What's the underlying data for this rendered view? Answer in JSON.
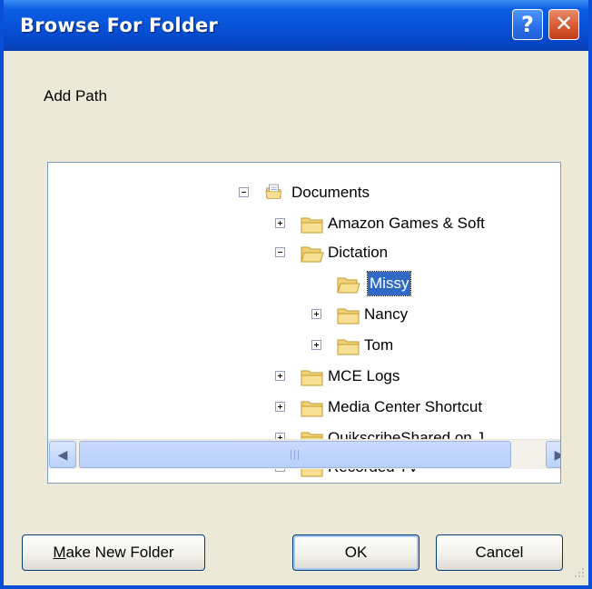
{
  "window": {
    "title": "Browse For Folder"
  },
  "titlebar": {
    "help_glyph": "?",
    "close_glyph": "✕"
  },
  "instruction": "Add Path",
  "tree": {
    "items": [
      {
        "label": "Documents",
        "expander": "minus",
        "icon": "documents-folder-icon",
        "selected": false
      },
      {
        "label": "Amazon Games & Soft",
        "expander": "plus",
        "icon": "folder-icon",
        "selected": false
      },
      {
        "label": "Dictation",
        "expander": "minus",
        "icon": "folder-open-icon",
        "selected": false
      },
      {
        "label": "Missy",
        "expander": "none",
        "icon": "folder-open-icon",
        "selected": true
      },
      {
        "label": "Nancy",
        "expander": "plus",
        "icon": "folder-icon",
        "selected": false
      },
      {
        "label": "Tom",
        "expander": "plus",
        "icon": "folder-icon",
        "selected": false
      },
      {
        "label": "MCE Logs",
        "expander": "plus",
        "icon": "folder-icon",
        "selected": false
      },
      {
        "label": "Media Center Shortcut",
        "expander": "plus",
        "icon": "folder-icon",
        "selected": false
      },
      {
        "label": "QuikscribeShared on J",
        "expander": "plus",
        "icon": "folder-icon",
        "selected": false
      },
      {
        "label": "Recorded TV",
        "expander": "plus",
        "icon": "folder-icon",
        "selected": false
      }
    ],
    "scroll_icons": {
      "up": "▲",
      "down": "▼",
      "left": "◀",
      "right": "▶"
    }
  },
  "buttons": {
    "make_new_folder_underlined": "M",
    "make_new_folder_rest": "ake New Folder",
    "ok": "OK",
    "cancel": "Cancel"
  },
  "colors": {
    "titlebar": "#0753d8",
    "selection": "#316ac5",
    "dialog_bg": "#ece9d8"
  }
}
